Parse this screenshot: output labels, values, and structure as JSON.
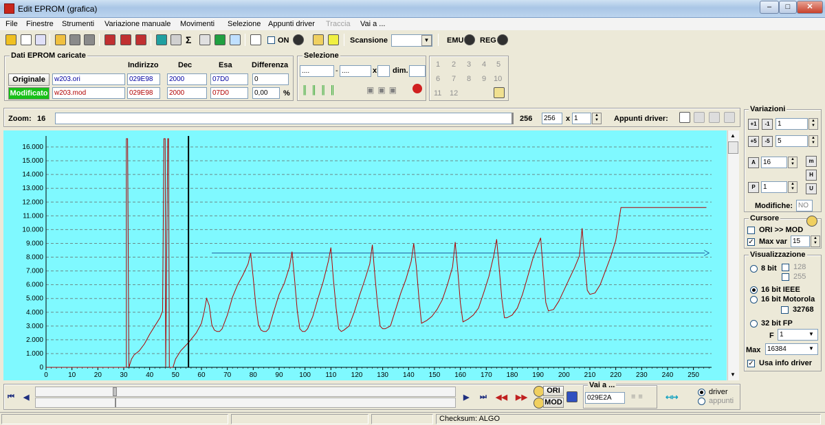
{
  "window": {
    "title": "Edit EPROM (grafica)"
  },
  "menu": [
    "File",
    "Finestre",
    "Strumenti",
    "Variazione manuale",
    "Movimenti",
    "Selezione",
    "Appunti driver",
    "Traccia",
    "Vai a ..."
  ],
  "menu_disabled": "Traccia",
  "toolbar": {
    "on_label": "ON",
    "scansione_label": "Scansione",
    "emu_label": "EMU",
    "reg_label": "REG"
  },
  "eprom": {
    "legend": "Dati EPROM caricate",
    "headers": {
      "indirizzo": "Indirizzo",
      "dec": "Dec",
      "esa": "Esa",
      "differenza": "Differenza"
    },
    "originale": {
      "label": "Originale",
      "file": "w203.ori",
      "indirizzo": "029E98",
      "dec": "2000",
      "esa": "07D0",
      "diff": "0"
    },
    "modificato": {
      "label": "Modificato",
      "file": "w203.mod",
      "indirizzo": "029E98",
      "dec": "2000",
      "esa": "07D0",
      "diff": "0,00",
      "diff_unit": "%"
    }
  },
  "selezione": {
    "legend": "Selezione",
    "from": "....",
    "to": "....",
    "x": "x",
    "dim": "dim."
  },
  "numpad": [
    "1",
    "2",
    "3",
    "4",
    "5",
    "6",
    "7",
    "8",
    "9",
    "10",
    "11",
    "12"
  ],
  "zoom": {
    "label": "Zoom:",
    "value": "16",
    "max": "256",
    "field": "256",
    "mult_label": "x",
    "mult": "1",
    "appunti": "Appunti driver:"
  },
  "variazioni": {
    "legend": "Variazioni",
    "v1": "1",
    "v2": "5",
    "v3": "16",
    "v4": "1",
    "modifiche_label": "Modifiche:",
    "modifiche": "NO"
  },
  "cursore": {
    "legend": "Cursore",
    "ori_mod": "ORI >> MOD",
    "max_var_label": "Max var",
    "max_var": "15"
  },
  "visualizzazione": {
    "legend": "Visualizzazione",
    "opt_8bit": "8 bit",
    "opt_128": "128",
    "opt_255": "255",
    "opt_16ieee": "16 bit IEEE",
    "opt_16moto": "16 bit Motorola",
    "opt_32768": "32768",
    "opt_32fp": "32 bit FP",
    "f_label": "F",
    "f_value": "1",
    "max_label": "Max",
    "max_value": "16384",
    "usa_info": "Usa info driver"
  },
  "bottom": {
    "ori": "ORI",
    "mod": "MOD",
    "vai_legend": "Vai a ...",
    "vai_value": "029E2A",
    "driver": "driver",
    "appunti": "appunti"
  },
  "status": {
    "checksum": "Checksum: ALGO"
  },
  "chart_data": {
    "type": "line",
    "xlim": [
      0,
      257
    ],
    "ylim": [
      0,
      16600
    ],
    "x_ticks": [
      0,
      10,
      20,
      30,
      40,
      50,
      60,
      70,
      80,
      90,
      100,
      110,
      120,
      130,
      140,
      150,
      160,
      170,
      180,
      190,
      200,
      210,
      220,
      230,
      240,
      250
    ],
    "y_ticks": [
      {
        "v": 0,
        "t": "0"
      },
      {
        "v": 1000,
        "t": "1.000"
      },
      {
        "v": 2000,
        "t": "2.000"
      },
      {
        "v": 3000,
        "t": "3.000"
      },
      {
        "v": 4000,
        "t": "4.000"
      },
      {
        "v": 5000,
        "t": "5.000"
      },
      {
        "v": 6000,
        "t": "6.000"
      },
      {
        "v": 7000,
        "t": "7.000"
      },
      {
        "v": 8000,
        "t": "8.000"
      },
      {
        "v": 9000,
        "t": "9.000"
      },
      {
        "v": 10000,
        "t": "10.000"
      },
      {
        "v": 11000,
        "t": "11.000"
      },
      {
        "v": 12000,
        "t": "12.000"
      },
      {
        "v": 13000,
        "t": "13.000"
      },
      {
        "v": 14000,
        "t": "14.000"
      },
      {
        "v": 15000,
        "t": "15.000"
      },
      {
        "v": 16000,
        "t": "16.000"
      }
    ],
    "grid": true,
    "cursor_x": 55,
    "arrow": {
      "x1": 64,
      "x2": 256,
      "y": 8300
    },
    "series": [
      {
        "color": "#b00000",
        "points": [
          [
            0,
            0
          ],
          [
            31,
            0
          ],
          [
            31,
            16600
          ],
          [
            31.5,
            16600
          ],
          [
            32,
            0
          ],
          [
            33,
            600
          ],
          [
            34,
            900
          ],
          [
            36,
            1200
          ],
          [
            38,
            1700
          ],
          [
            40,
            2400
          ],
          [
            42,
            3000
          ],
          [
            44,
            3600
          ],
          [
            45,
            4100
          ],
          [
            45.5,
            16600
          ],
          [
            46,
            16600
          ],
          [
            46.2,
            0
          ],
          [
            47,
            16600
          ],
          [
            47.3,
            16600
          ],
          [
            47.6,
            0
          ],
          [
            49,
            0
          ],
          [
            50,
            600
          ],
          [
            52,
            1200
          ],
          [
            55,
            1800
          ],
          [
            58,
            2500
          ],
          [
            60,
            3200
          ],
          [
            61,
            4000
          ],
          [
            62,
            5000
          ],
          [
            63,
            4500
          ],
          [
            64,
            3100
          ],
          [
            65,
            2700
          ],
          [
            66,
            2600
          ],
          [
            67,
            2600
          ],
          [
            68,
            2800
          ],
          [
            70,
            3800
          ],
          [
            72,
            5100
          ],
          [
            74,
            6000
          ],
          [
            76,
            6700
          ],
          [
            78,
            7500
          ],
          [
            79,
            8300
          ],
          [
            80,
            6500
          ],
          [
            81,
            4500
          ],
          [
            82,
            3100
          ],
          [
            83,
            2700
          ],
          [
            84,
            2600
          ],
          [
            85,
            2600
          ],
          [
            86,
            2800
          ],
          [
            88,
            4100
          ],
          [
            90,
            5300
          ],
          [
            92,
            6100
          ],
          [
            94,
            7300
          ],
          [
            95,
            8400
          ],
          [
            96,
            6300
          ],
          [
            97,
            4100
          ],
          [
            98,
            2800
          ],
          [
            99,
            2600
          ],
          [
            100,
            2600
          ],
          [
            101,
            2800
          ],
          [
            103,
            3700
          ],
          [
            105,
            5000
          ],
          [
            107,
            6200
          ],
          [
            109,
            7700
          ],
          [
            110,
            8700
          ],
          [
            111,
            6300
          ],
          [
            112,
            4300
          ],
          [
            113,
            2800
          ],
          [
            114,
            2600
          ],
          [
            115,
            2700
          ],
          [
            117,
            3000
          ],
          [
            119,
            4000
          ],
          [
            121,
            5200
          ],
          [
            123,
            6300
          ],
          [
            125,
            7500
          ],
          [
            126,
            8900
          ],
          [
            127,
            6600
          ],
          [
            128,
            4600
          ],
          [
            129,
            3000
          ],
          [
            130,
            2800
          ],
          [
            131,
            2800
          ],
          [
            133,
            3000
          ],
          [
            135,
            4200
          ],
          [
            137,
            5400
          ],
          [
            139,
            6400
          ],
          [
            141,
            7700
          ],
          [
            142,
            9000
          ],
          [
            143,
            7300
          ],
          [
            144,
            5000
          ],
          [
            145,
            3200
          ],
          [
            147,
            3400
          ],
          [
            149,
            3700
          ],
          [
            151,
            4200
          ],
          [
            153,
            4900
          ],
          [
            155,
            6000
          ],
          [
            157,
            7300
          ],
          [
            158,
            9100
          ],
          [
            159,
            7000
          ],
          [
            160,
            4700
          ],
          [
            161,
            3300
          ],
          [
            163,
            3500
          ],
          [
            165,
            3800
          ],
          [
            167,
            4300
          ],
          [
            169,
            5400
          ],
          [
            171,
            6600
          ],
          [
            173,
            8200
          ],
          [
            174,
            9300
          ],
          [
            175,
            7200
          ],
          [
            176,
            5000
          ],
          [
            177,
            3600
          ],
          [
            178,
            3600
          ],
          [
            180,
            3800
          ],
          [
            182,
            4300
          ],
          [
            184,
            5300
          ],
          [
            186,
            6600
          ],
          [
            188,
            7900
          ],
          [
            190,
            8900
          ],
          [
            191,
            9400
          ],
          [
            192,
            7000
          ],
          [
            193,
            4700
          ],
          [
            194,
            4100
          ],
          [
            196,
            4200
          ],
          [
            198,
            4800
          ],
          [
            200,
            5600
          ],
          [
            202,
            6400
          ],
          [
            204,
            7200
          ],
          [
            206,
            8100
          ],
          [
            207,
            10100
          ],
          [
            208,
            7800
          ],
          [
            209,
            5600
          ],
          [
            210,
            5300
          ],
          [
            212,
            5400
          ],
          [
            214,
            6000
          ],
          [
            216,
            7000
          ],
          [
            218,
            8000
          ],
          [
            219,
            8600
          ],
          [
            220,
            9200
          ],
          [
            221,
            10400
          ],
          [
            222,
            11600
          ],
          [
            255,
            11600
          ]
        ]
      }
    ]
  }
}
